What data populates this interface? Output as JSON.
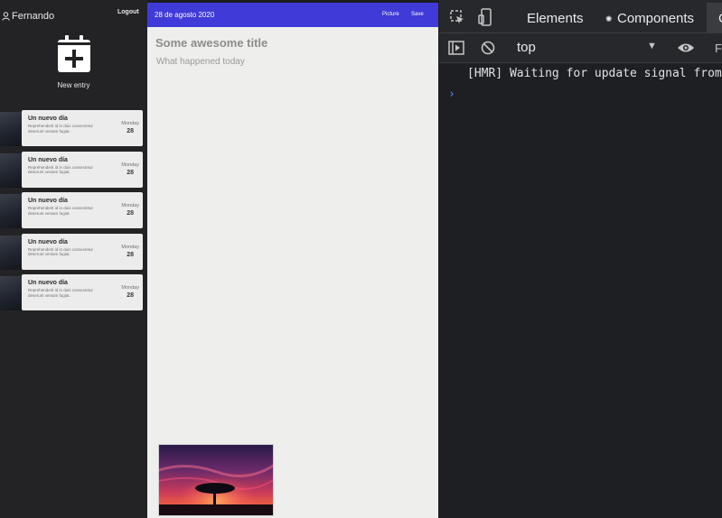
{
  "sidebar": {
    "user_name": "Fernando",
    "logout_label": "Logout",
    "new_entry_label": "New entry",
    "entries": [
      {
        "title": "Un nuevo día",
        "text": "Reprehenderit id in duis consectetur deserunt veniam fugiat.",
        "day": "Monday",
        "date": "28"
      },
      {
        "title": "Un nuevo día",
        "text": "Reprehenderit id in duis consectetur deserunt veniam fugiat.",
        "day": "Monday",
        "date": "28"
      },
      {
        "title": "Un nuevo día",
        "text": "Reprehenderit id in duis consectetur deserunt veniam fugiat.",
        "day": "Monday",
        "date": "28"
      },
      {
        "title": "Un nuevo día",
        "text": "Reprehenderit id in duis consectetur deserunt veniam fugiat.",
        "day": "Monday",
        "date": "28"
      },
      {
        "title": "Un nuevo día",
        "text": "Reprehenderit id in duis consectetur deserunt veniam fugiat.",
        "day": "Monday",
        "date": "28"
      }
    ]
  },
  "editor": {
    "date": "28 de agosto 2020",
    "picture_label": "Picture",
    "save_label": "Save",
    "title": "Some awesome title",
    "body": "What happened today"
  },
  "devtools": {
    "tabs": [
      "Elements",
      "Components"
    ],
    "next_tab_letter": "C",
    "context": "top",
    "console_lines": [
      "[HMR] Waiting for update signal from"
    ],
    "prompt_symbol": "›"
  },
  "colors": {
    "sidebar_bg": "#232325",
    "editor_bar": "#3f3ad8",
    "editor_bg": "#eeeeec",
    "devtools_bg": "#202124",
    "prompt_blue": "#4c8bf5"
  }
}
